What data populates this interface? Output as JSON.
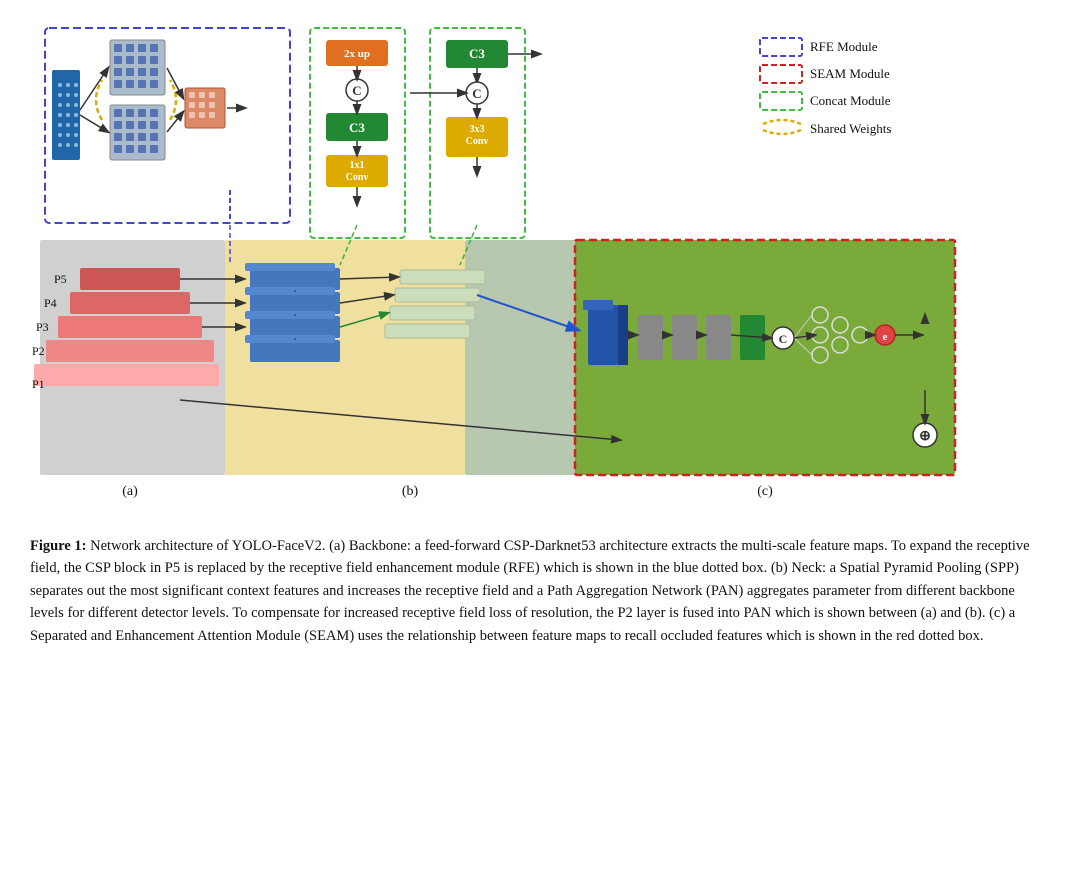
{
  "legend": {
    "items": [
      {
        "label": "RFE Module",
        "type": "dashed-blue"
      },
      {
        "label": "SEAM Module",
        "type": "dashed-red"
      },
      {
        "label": "Concat Module",
        "type": "dashed-green"
      },
      {
        "label": "Shared Weights",
        "type": "yellow-arc"
      }
    ]
  },
  "diagram_labels": {
    "a": "(a)",
    "b": "(b)",
    "c": "(c)"
  },
  "caption": {
    "figure_label": "Figure 1:",
    "text": " Network architecture of YOLO-FaceV2. (a) Backbone: a feed-forward CSP-Darknet53 architecture extracts the multi-scale feature maps. To expand the receptive field, the CSP block in P5 is replaced by the receptive field enhancement module (RFE) which is shown in the blue dotted box. (b) Neck: a Spatial Pyramid Pooling (SPP) separates out the most significant context features and increases the receptive field and a Path Aggregation Network (PAN) aggregates parameter from different backbone levels for different detector levels. To compensate for increased receptive field loss of resolution, the P2 layer is fused into PAN which is shown between (a) and (b). (c) a Separated and Enhancement Attention Module (SEAM) uses the relationship between feature maps to recall occluded features which is shown in the red dotted box."
  },
  "pyramid_labels": [
    "P5",
    "P4",
    "P3",
    "P2",
    "P1"
  ],
  "blocks": {
    "two_x_up": "2x up",
    "c3_1": "C3",
    "one_x_one_conv": "1x1\nConv",
    "c3_2": "C3",
    "three_x_three_conv": "3x3\nConv"
  }
}
